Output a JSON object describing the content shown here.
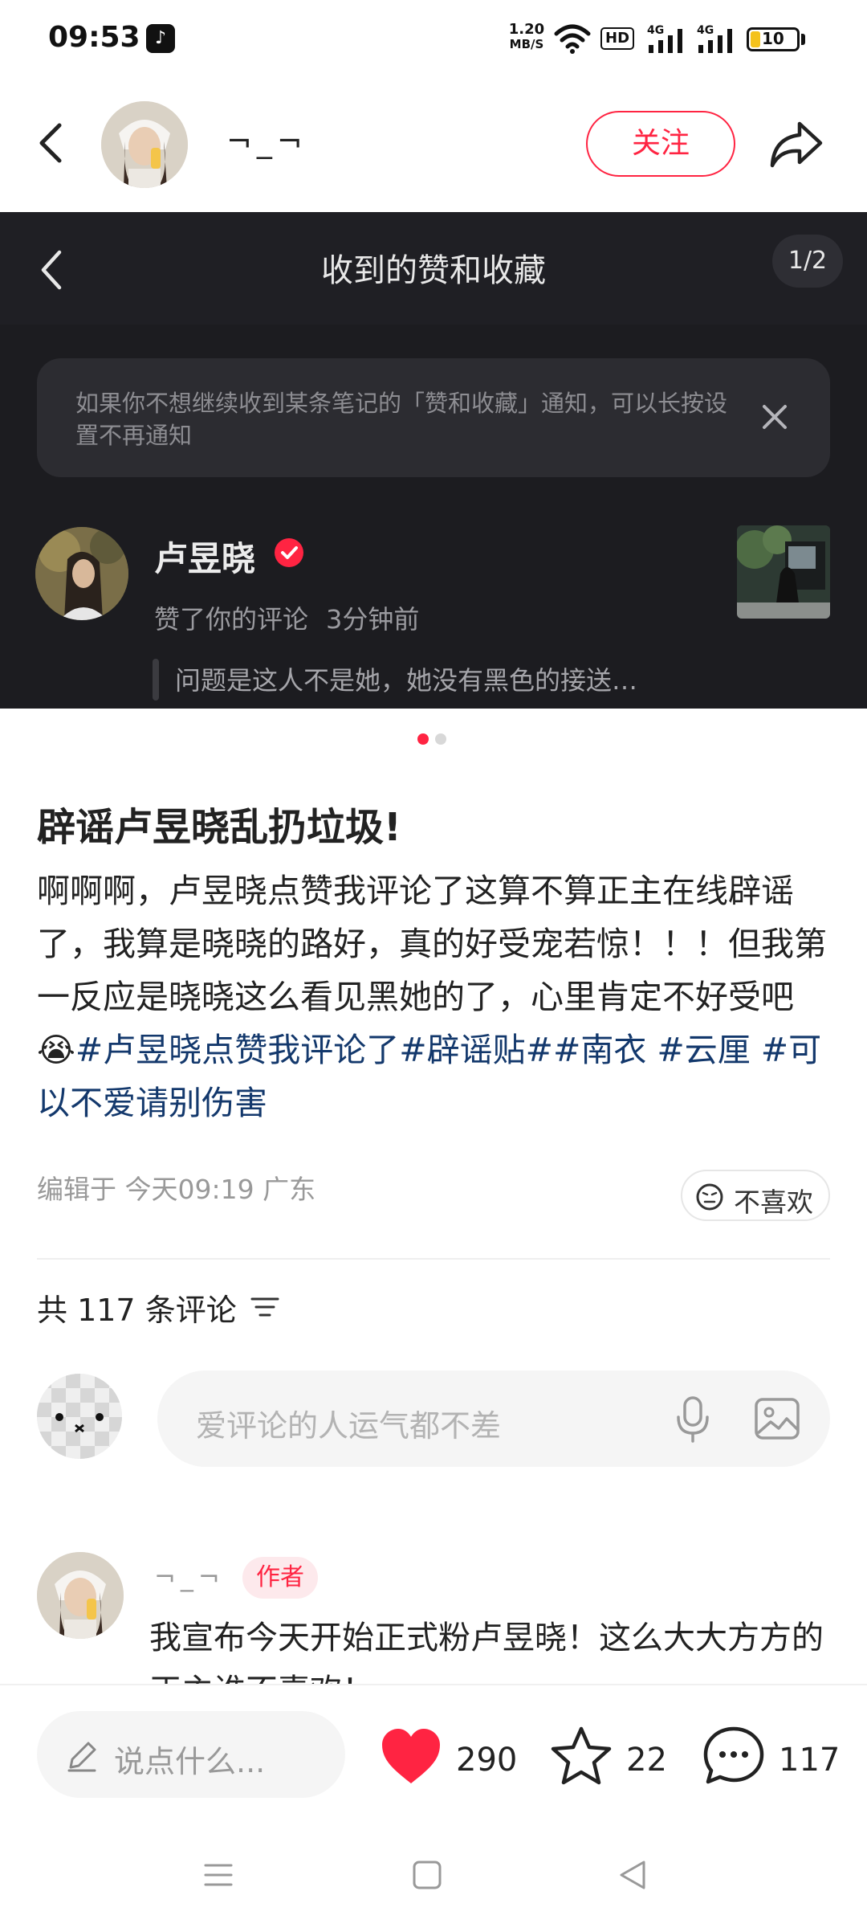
{
  "status_bar": {
    "time": "09:53",
    "net_speed_value": "1.20",
    "net_speed_unit": "MB/S",
    "hd_label": "HD",
    "signal1_label": "4G",
    "signal2_label": "4G",
    "battery_level": "10"
  },
  "top_nav": {
    "author_name": "¬_¬",
    "follow_label": "关注"
  },
  "image_panel": {
    "title": "收到的赞和收藏",
    "counter": "1/2",
    "notice": "如果你不想继续收到某条笔记的「赞和收藏」通知，可以长按设置不再通知",
    "user_name": "卢昱晓",
    "action": "赞了你的评论",
    "time": "3分钟前",
    "quote": "问题是这人不是她，她没有黑色的接送…"
  },
  "carousel": {
    "active_index": 1,
    "total": 2
  },
  "post": {
    "title": "辟谣卢昱晓乱扔垃圾!",
    "body": "啊啊啊，卢昱晓点赞我评论了这算不算正主在线辟谣了，我算是晓晓的路好，真的好受宠若惊！！！但我第一反应是晓晓这么看见黑她的了，心里肯定不好受吧",
    "emoji": "😭",
    "tags": [
      "#卢昱晓点赞我评论了#",
      "辟谣贴#",
      "南衣",
      " #云厘",
      " #可以不爱请别伤害"
    ],
    "edited_label": "编辑于",
    "edited_time": "今天09:19",
    "location": "广东",
    "dislike_label": "不喜欢"
  },
  "comments": {
    "count_label": "共 117 条评论",
    "input_placeholder": "爱评论的人运气都不差",
    "first": {
      "user": "¬_¬",
      "badge": "作者",
      "text": "我宣布今天开始正式粉卢昱晓！这么大大方方的正主谁不喜欢！"
    }
  },
  "bottom_bar": {
    "say_placeholder": "说点什么...",
    "likes": "290",
    "collects": "22",
    "comments": "117"
  },
  "colors": {
    "accent": "#ff2442",
    "tag": "#13386c",
    "dark_panel": "#1c1c20"
  }
}
